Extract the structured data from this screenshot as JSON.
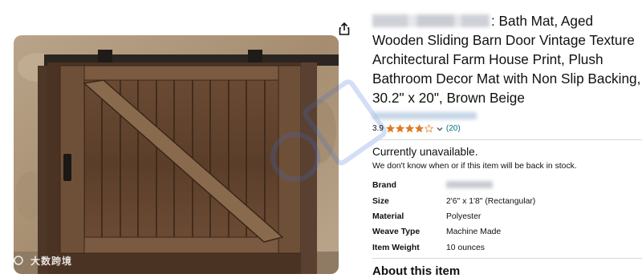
{
  "product": {
    "title_text": ": Bath Mat, Aged Wooden Sliding Barn Door Vintage Texture Architectural Farm House Print, Plush Bathroom Decor Mat with Non Slip Backing, 30.2\" x 20\", Brown Beige",
    "rating_value": "3.9",
    "rating_stars": 3.9,
    "review_count": "(20)"
  },
  "availability": {
    "status": "Currently unavailable.",
    "note": "We don't know when or if this item will be back in stock."
  },
  "specs": [
    {
      "key": "Brand",
      "value": ""
    },
    {
      "key": "Size",
      "value": "2'6\" x 1'8\" (Rectangular)"
    },
    {
      "key": "Material",
      "value": "Polyester"
    },
    {
      "key": "Weave Type",
      "value": "Machine Made"
    },
    {
      "key": "Item Weight",
      "value": "10 ounces"
    }
  ],
  "section": {
    "about_heading": "About this item"
  },
  "watermark": {
    "corner_text": "大数跨境"
  },
  "icons": {
    "share": "share-icon",
    "star": "star-icon",
    "chevron": "chevron-down-icon"
  },
  "colors": {
    "star": "#DE7921",
    "link": "#007185",
    "text": "#0F1111",
    "divider": "#D5D9D9"
  }
}
